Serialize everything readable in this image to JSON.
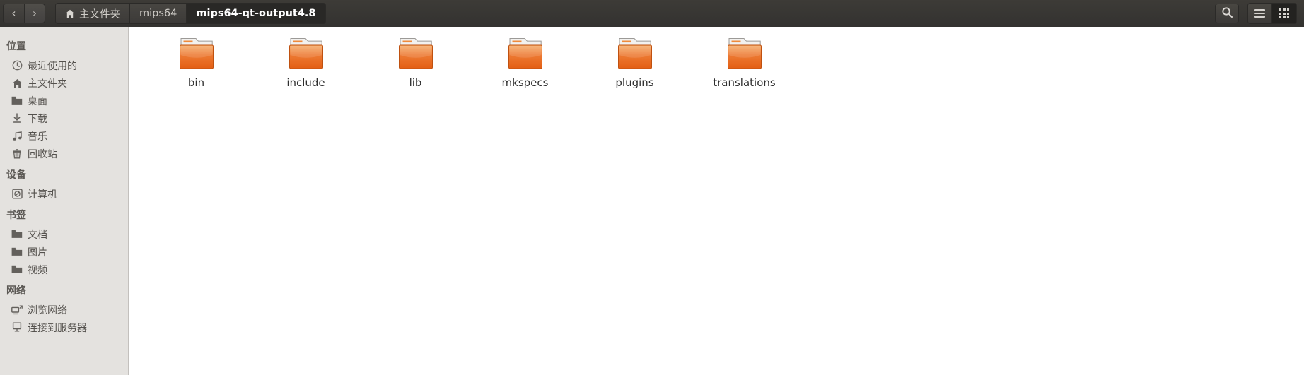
{
  "window": {
    "title": "mips64-qt-output4.8"
  },
  "topbar": {
    "back_label": "‹",
    "forward_label": "›",
    "breadcrumbs": [
      {
        "label": "主文件夹",
        "icon": "home-icon",
        "active": false
      },
      {
        "label": "mips64",
        "icon": "",
        "active": false
      },
      {
        "label": "mips64-qt-output4.8",
        "icon": "",
        "active": true
      }
    ],
    "search_icon": "search-icon",
    "list_view_icon": "list-view-icon",
    "grid_view_icon": "grid-view-icon"
  },
  "sidebar": {
    "sections": [
      {
        "heading": "位置",
        "items": [
          {
            "label": "最近使用的",
            "icon": "clock-icon"
          },
          {
            "label": "主文件夹",
            "icon": "home-icon"
          },
          {
            "label": "桌面",
            "icon": "folder-icon"
          },
          {
            "label": "下载",
            "icon": "download-icon"
          },
          {
            "label": "音乐",
            "icon": "music-icon"
          },
          {
            "label": "回收站",
            "icon": "trash-icon"
          }
        ]
      },
      {
        "heading": "设备",
        "items": [
          {
            "label": "计算机",
            "icon": "computer-disc-icon"
          }
        ]
      },
      {
        "heading": "书签",
        "items": [
          {
            "label": "文档",
            "icon": "folder-icon"
          },
          {
            "label": "图片",
            "icon": "folder-icon"
          },
          {
            "label": "视频",
            "icon": "folder-icon"
          }
        ]
      },
      {
        "heading": "网络",
        "items": [
          {
            "label": "浏览网络",
            "icon": "network-browse-icon"
          },
          {
            "label": "连接到服务器",
            "icon": "server-connect-icon"
          }
        ]
      }
    ]
  },
  "main": {
    "files": [
      {
        "label": "bin",
        "type": "folder"
      },
      {
        "label": "include",
        "type": "folder"
      },
      {
        "label": "lib",
        "type": "folder"
      },
      {
        "label": "mkspecs",
        "type": "folder"
      },
      {
        "label": "plugins",
        "type": "folder"
      },
      {
        "label": "translations",
        "type": "folder"
      }
    ]
  },
  "colors": {
    "folder_orange": "#e8601c",
    "folder_orange_light": "#f0a35e",
    "topbar_dark": "#3b3936",
    "sidebar_bg": "#e4e2df",
    "content_bg": "#ffffff"
  }
}
